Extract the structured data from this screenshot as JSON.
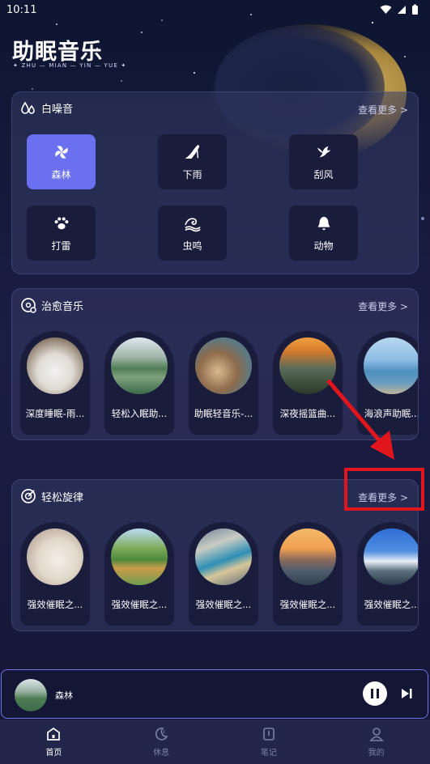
{
  "status_bar": {
    "time": "10:11"
  },
  "header": {
    "title": "助眠音乐",
    "subtitle": "✦ ZHU — MIAN — YIN — YUE ✦"
  },
  "white_noise": {
    "title": "白噪音",
    "more": "查看更多 >",
    "items": [
      {
        "label": "森林",
        "icon": "pinwheel-icon",
        "active": true
      },
      {
        "label": "下雨",
        "icon": "high-heel-icon"
      },
      {
        "label": "刮风",
        "icon": "bird-icon"
      },
      {
        "label": "打雷",
        "icon": "paw-icon"
      },
      {
        "label": "虫鸣",
        "icon": "wave-icon"
      },
      {
        "label": "动物",
        "icon": "bell-icon"
      }
    ]
  },
  "healing": {
    "title": "治愈音乐",
    "more": "查看更多 >",
    "items": [
      {
        "label": "深度睡眠-雨..."
      },
      {
        "label": "轻松入眠助..."
      },
      {
        "label": "助眠轻音乐-..."
      },
      {
        "label": "深夜摇篮曲..."
      },
      {
        "label": "海浪声助眠..."
      }
    ]
  },
  "melody": {
    "title": "轻松旋律",
    "more": "查看更多 >",
    "items": [
      {
        "label": "强效催眠之..."
      },
      {
        "label": "强效催眠之..."
      },
      {
        "label": "强效催眠之..."
      },
      {
        "label": "强效催眠之..."
      },
      {
        "label": "强效催眠之..."
      }
    ]
  },
  "player": {
    "track": "森林",
    "state": "playing"
  },
  "tabs": [
    {
      "label": "首页",
      "icon": "home-icon",
      "active": true
    },
    {
      "label": "休息",
      "icon": "moon-icon"
    },
    {
      "label": "笔记",
      "icon": "notebook-icon"
    },
    {
      "label": "我的",
      "icon": "user-icon"
    }
  ],
  "colors": {
    "accent": "#6a70f0",
    "highlight": "#e0161c"
  }
}
